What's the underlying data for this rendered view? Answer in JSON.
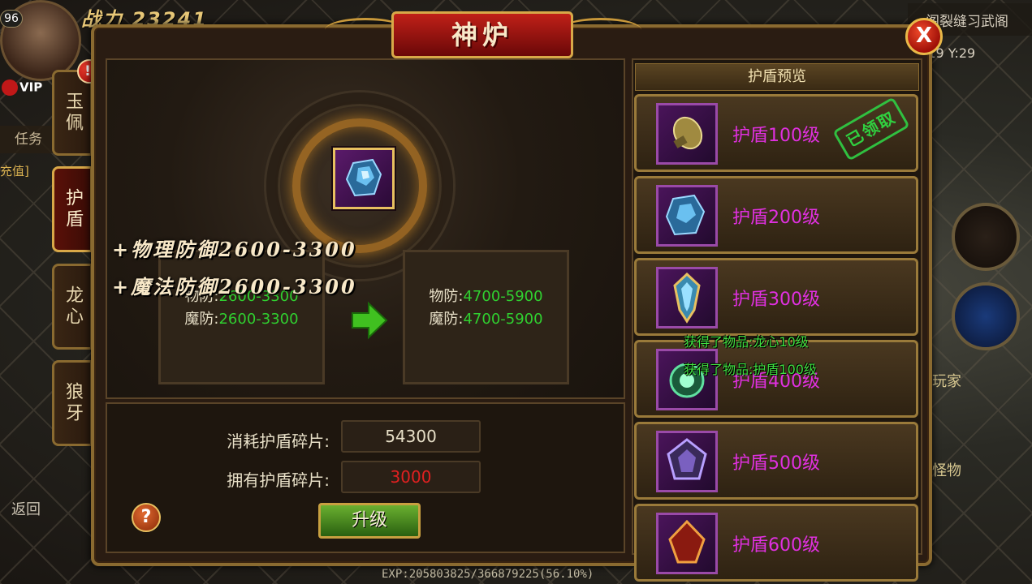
{
  "hud": {
    "level": "96",
    "power_label": "战力",
    "power_value": "23241",
    "vip": "VIP",
    "task": "任务",
    "recharge": "充值]",
    "back": "返回",
    "map_name": "阁裂缝习武阁",
    "coords": "X:19 Y:29",
    "player": "玩家",
    "monster": "怪物",
    "exp": "EXP:205803825/366879225(56.10%)"
  },
  "panel": {
    "title": "神炉",
    "close_label": "X"
  },
  "tabs": [
    {
      "label": "玉佩",
      "active": false,
      "badge": "!"
    },
    {
      "label": "护盾",
      "active": true,
      "badge": ""
    },
    {
      "label": "龙心",
      "active": false,
      "badge": ""
    },
    {
      "label": "狼牙",
      "active": false,
      "badge": ""
    }
  ],
  "current_stats": {
    "phys_label": "物防:",
    "phys_value": "2600-3300",
    "magic_label": "魔防:",
    "magic_value": "2600-3300"
  },
  "next_stats": {
    "phys_label": "物防:",
    "phys_value": "4700-5900",
    "magic_label": "魔防:",
    "magic_value": "4700-5900"
  },
  "floating_text": {
    "line1": "+物理防御2600-3300",
    "line2": "+魔法防御2600-3300"
  },
  "cost": {
    "consume_label": "消耗护盾碎片:",
    "consume_value": "54300",
    "own_label": "拥有护盾碎片:",
    "own_value": "3000",
    "upgrade_label": "升级",
    "help_label": "?"
  },
  "preview": {
    "header": "护盾预览",
    "claimed_stamp": "已领取",
    "items": [
      {
        "name": "护盾100级",
        "claimed": true
      },
      {
        "name": "护盾200级",
        "claimed": false
      },
      {
        "name": "护盾300级",
        "claimed": false
      },
      {
        "name": "护盾400级",
        "claimed": false
      },
      {
        "name": "护盾500级",
        "claimed": false
      },
      {
        "name": "护盾600级",
        "claimed": false
      }
    ]
  },
  "messages": [
    "获得了物品:龙心10级",
    "获得了物品:护盾100级"
  ],
  "colors": {
    "accent_gold": "#c8983a",
    "title_red": "#c02018",
    "stat_green": "#30d030",
    "item_name_magenta": "#e030e0",
    "insufficient_red": "#e02020",
    "message_green": "#40e040"
  }
}
